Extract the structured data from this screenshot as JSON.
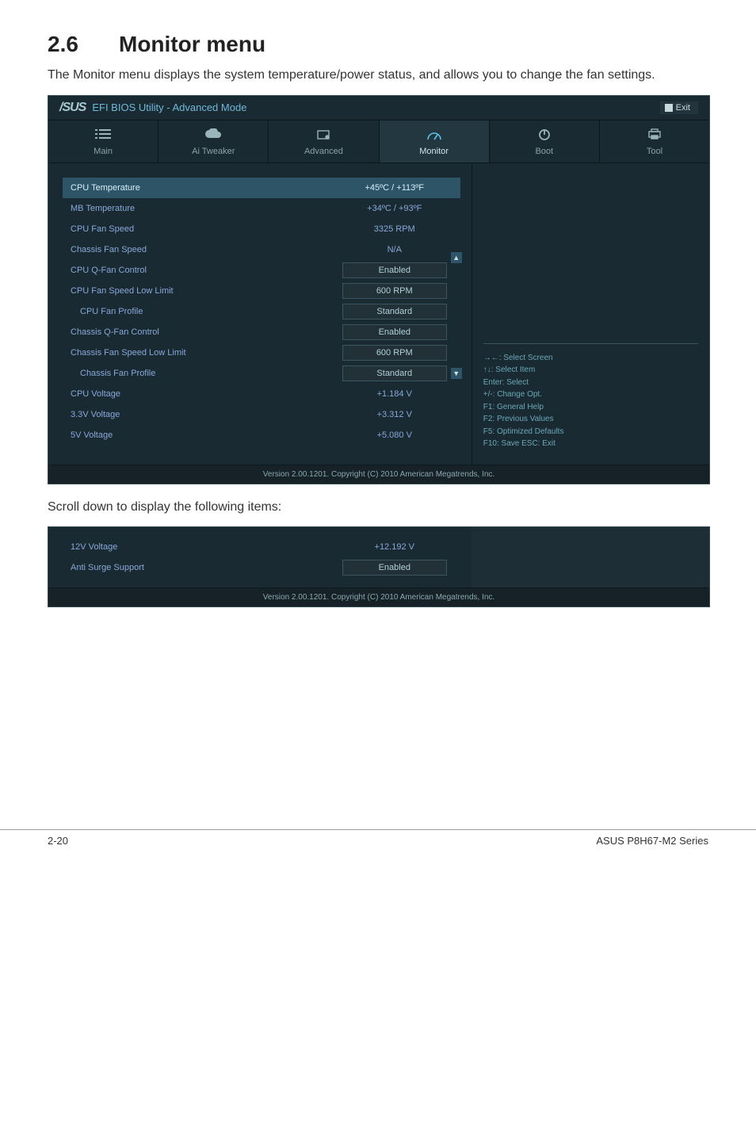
{
  "page": {
    "heading_number": "2.6",
    "heading_title": "Monitor menu",
    "intro": "The Monitor menu displays the system temperature/power status, and allows you to change the fan settings.",
    "scroll_note": "Scroll down to display the following items:",
    "footer_left": "2-20",
    "footer_right": "ASUS P8H67-M2 Series"
  },
  "bios": {
    "brand": "/SUS",
    "title": "EFI BIOS Utility - Advanced Mode",
    "exit_label": "Exit",
    "footer": "Version 2.00.1201.  Copyright (C) 2010 American Megatrends, Inc.",
    "tabs": [
      {
        "label": "Main",
        "icon": "list"
      },
      {
        "label": "Ai Tweaker",
        "icon": "cloud"
      },
      {
        "label": "Advanced",
        "icon": "chip"
      },
      {
        "label": "Monitor",
        "icon": "gauge",
        "active": true
      },
      {
        "label": "Boot",
        "icon": "power"
      },
      {
        "label": "Tool",
        "icon": "printer"
      }
    ],
    "rows": [
      {
        "label": "CPU Temperature",
        "value": "+45ºC / +113ºF",
        "selected": true
      },
      {
        "label": "MB Temperature",
        "value": "+34ºC / +93ºF"
      },
      {
        "label": "CPU Fan Speed",
        "value": "3325 RPM"
      },
      {
        "label": "Chassis Fan Speed",
        "value": "N/A"
      },
      {
        "label": "CPU Q-Fan Control",
        "value": "Enabled",
        "dropdown": true
      },
      {
        "label": "CPU Fan Speed Low Limit",
        "value": "600 RPM",
        "dropdown": true
      },
      {
        "label": "CPU Fan Profile",
        "value": "Standard",
        "dropdown": true,
        "indent": true
      },
      {
        "label": "Chassis Q-Fan Control",
        "value": "Enabled",
        "dropdown": true
      },
      {
        "label": "Chassis Fan Speed Low Limit",
        "value": "600 RPM",
        "dropdown": true
      },
      {
        "label": "Chassis Fan Profile",
        "value": "Standard",
        "dropdown": true,
        "indent": true
      },
      {
        "label": "CPU Voltage",
        "value": "+1.184 V"
      },
      {
        "label": "3.3V Voltage",
        "value": "+3.312 V"
      },
      {
        "label": "5V Voltage",
        "value": "+5.080 V"
      }
    ],
    "help_lines": [
      "→←: Select Screen",
      "↑↓: Select Item",
      "Enter: Select",
      "+/-: Change Opt.",
      "F1: General Help",
      "F2: Previous Values",
      "F5: Optimized Defaults",
      "F10: Save   ESC: Exit"
    ],
    "scroll_rows": [
      {
        "label": "12V Voltage",
        "value": "+12.192 V"
      },
      {
        "label": "Anti Surge Support",
        "value": "Enabled",
        "dropdown": true
      }
    ]
  }
}
